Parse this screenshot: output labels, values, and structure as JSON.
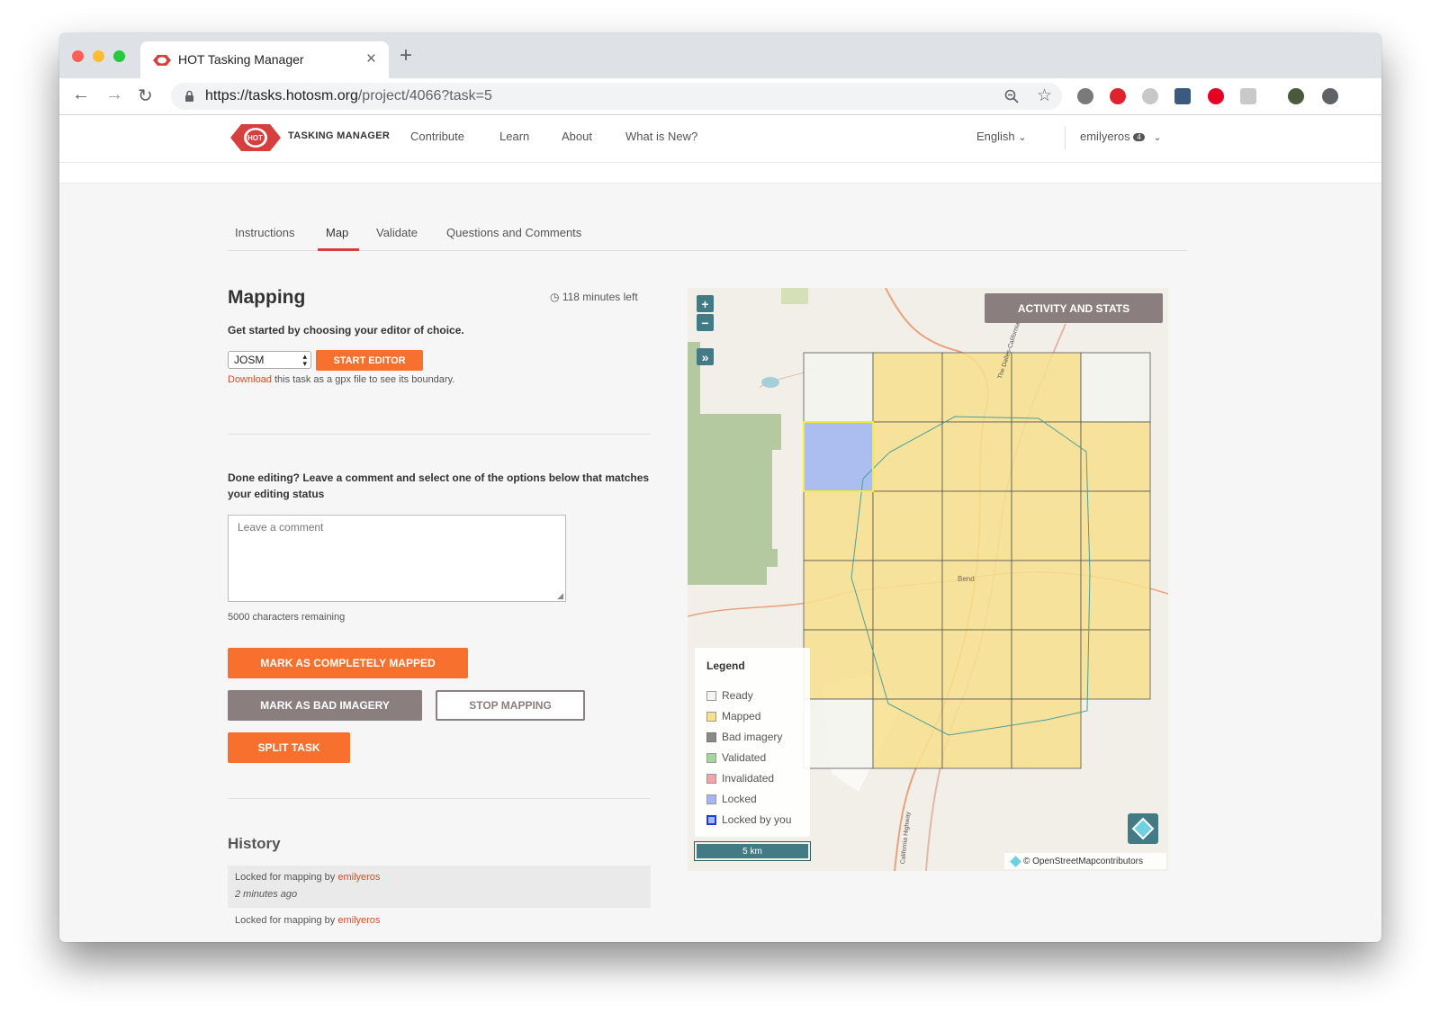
{
  "browser": {
    "tab_title": "HOT Tasking Manager",
    "url_host": "https://tasks.hotosm.org",
    "url_path": "/project/4066?task=5"
  },
  "header": {
    "logo_text": "HOT",
    "brand": "TASKING MANAGER",
    "nav": [
      "Contribute",
      "Learn",
      "About",
      "What is New?"
    ],
    "language": "English",
    "user": "emilyeros",
    "notification_count": "4"
  },
  "project_tabs": [
    "Instructions",
    "Map",
    "Validate",
    "Questions and Comments"
  ],
  "mapping": {
    "title": "Mapping",
    "time_left": "118 minutes left",
    "editor_prompt": "Get started by choosing your editor of choice.",
    "editor_selected": "JOSM",
    "start_editor": "Start Editor",
    "download_link": "Download",
    "download_text": " this task as a gpx file to see its boundary.",
    "done_prompt": "Done editing? Leave a comment and select one of the options below that matches your editing status",
    "comment_placeholder": "Leave a comment",
    "chars_remaining": "5000 characters remaining",
    "mark_mapped": "Mark as completely mapped",
    "mark_bad_imagery": "Mark as bad imagery",
    "stop_mapping": "Stop mapping",
    "split_task": "Split task"
  },
  "history": {
    "title": "History",
    "items": [
      {
        "text": "Locked for mapping by ",
        "user": "emilyeros",
        "time": "2 minutes ago"
      },
      {
        "text": "Locked for mapping by ",
        "user": "emilyeros",
        "time": ""
      }
    ]
  },
  "map": {
    "activity_button": "Activity and Stats",
    "zoom_in": "+",
    "zoom_out": "−",
    "expand": "»",
    "legend_title": "Legend",
    "legend": [
      {
        "label": "Ready",
        "color": "#f4f4f0",
        "border": "#999999"
      },
      {
        "label": "Mapped",
        "color": "#f7e08f",
        "border": "#999999"
      },
      {
        "label": "Bad imagery",
        "color": "#8a8a8a",
        "border": "#777777"
      },
      {
        "label": "Validated",
        "color": "#a8d4a0",
        "border": "#999999"
      },
      {
        "label": "Invalidated",
        "color": "#f5a3a8",
        "border": "#999999"
      },
      {
        "label": "Locked",
        "color": "#a3b8f0",
        "border": "#999999"
      },
      {
        "label": "Locked by you",
        "color": "#a3b8f0",
        "border": "#1b3fd6"
      }
    ],
    "scale": "5 km",
    "attribution_prefix": "© OpenStreetMap",
    "attribution_suffix": " contributors",
    "place_label": "Bend",
    "road_label": "The Dalles-California Highway",
    "road_label_2": "California Highway",
    "colors": {
      "mapped": "#f7e08f",
      "ready": "#f4f4f0",
      "locked": "#a3b8f0",
      "accent": "#f7702e",
      "teal": "#427b85"
    }
  }
}
